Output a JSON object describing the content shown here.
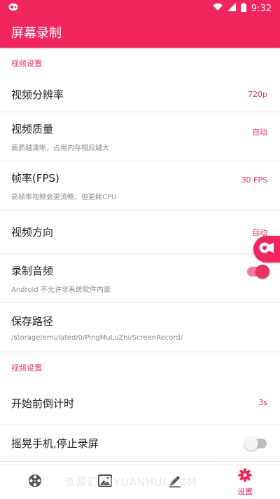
{
  "status_bar": {
    "time": "9:32"
  },
  "app_bar": {
    "title": "屏幕录制"
  },
  "sections": {
    "video": "视频设置",
    "video2": "视频设置"
  },
  "rows": {
    "resolution": {
      "title": "视频分辨率",
      "value": "720p"
    },
    "quality": {
      "title": "视频质量",
      "value": "自动",
      "subtitle": "画质越清晰，占用内存相应越大"
    },
    "fps": {
      "title": "帧率(FPS)",
      "value": "30 FPS",
      "subtitle": "高帧率视频会更流畅，但更耗CPU"
    },
    "orientation": {
      "title": "视频方向",
      "value": "自动"
    },
    "audio": {
      "title": "录制音频",
      "subtitle": "Android 不允许非系统软件内录",
      "enabled": true
    },
    "save_path": {
      "title": "保存路径",
      "subtitle": "/storage/emulated/0/PingMuLuZhi/ScreenRecord/"
    },
    "countdown": {
      "title": "开始前倒计时",
      "value": "3s"
    },
    "shake_stop": {
      "title": "摇晃手机,停止录屏",
      "enabled": false
    }
  },
  "bottom_nav": {
    "items": [
      {
        "icon": "film-reel-icon"
      },
      {
        "icon": "image-gallery-icon"
      },
      {
        "icon": "pencil-icon"
      },
      {
        "icon": "settings-gear-icon",
        "label": "设置",
        "active": true
      }
    ]
  },
  "watermark": {
    "text": "资源汇·ZIYUANHUI.COM"
  },
  "colors": {
    "accent": "#f2265e",
    "value_text": "#e8335f",
    "divider": "#e6e6e6"
  }
}
